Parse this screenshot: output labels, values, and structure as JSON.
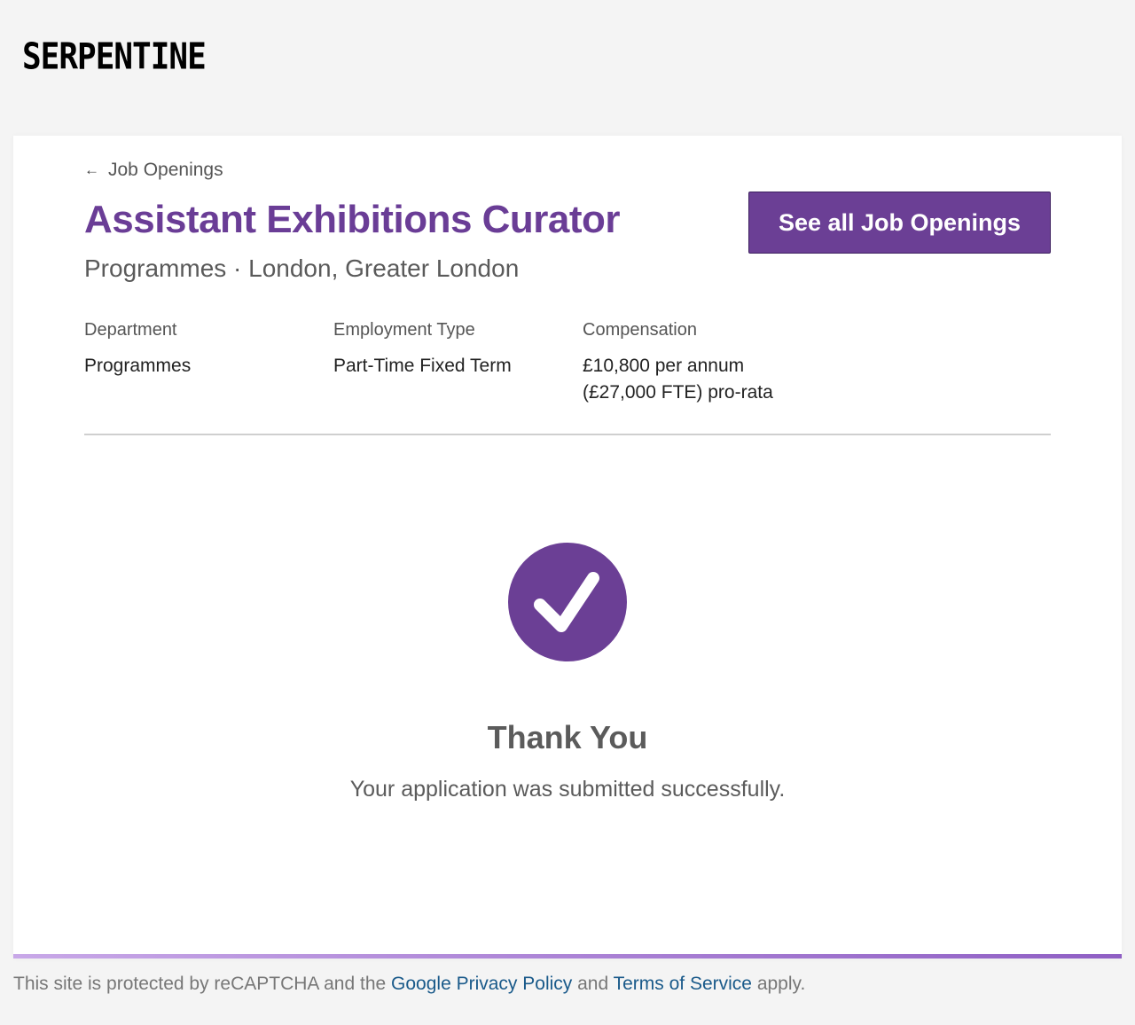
{
  "brand": {
    "logo_text": "SERPENTINE",
    "accent_color": "#6b3f95"
  },
  "nav": {
    "back_label": "Job Openings"
  },
  "job": {
    "title": "Assistant Exhibitions Curator",
    "subtitle": "Programmes · London, Greater London"
  },
  "header_button": {
    "label": "See all Job Openings"
  },
  "details": {
    "department": {
      "label": "Department",
      "value": "Programmes"
    },
    "employment_type": {
      "label": "Employment Type",
      "value": "Part-Time Fixed Term"
    },
    "compensation": {
      "label": "Compensation",
      "value_line1": "£10,800 per annum",
      "value_line2": "(£27,000 FTE) pro-rata"
    }
  },
  "confirmation": {
    "icon": "checkmark-icon",
    "title": "Thank You",
    "message": "Your application was submitted successfully."
  },
  "footer": {
    "text_before": "This site is protected by reCAPTCHA and the ",
    "privacy_link": "Google Privacy Policy",
    "text_middle": " and ",
    "terms_link": "Terms of Service",
    "text_after": " apply."
  }
}
